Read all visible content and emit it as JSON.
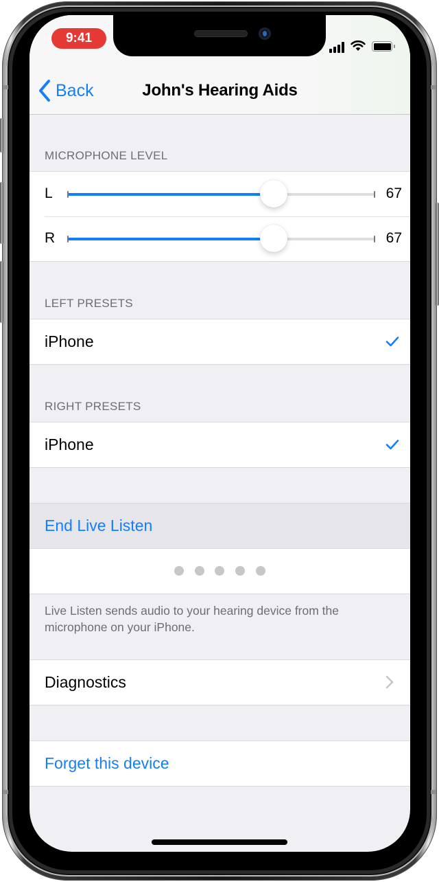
{
  "status_bar": {
    "time": "9:41",
    "time_pill_color": "#e53935",
    "icons": [
      "cellular-signal-icon",
      "wifi-icon",
      "battery-icon"
    ]
  },
  "nav": {
    "back_label": "Back",
    "title": "John's Hearing Aids",
    "accent_color": "#157efb"
  },
  "microphone_level": {
    "header": "MICROPHONE LEVEL",
    "sliders": [
      {
        "side": "L",
        "value": 67,
        "value_label": "67",
        "min": 0,
        "max": 100
      },
      {
        "side": "R",
        "value": 67,
        "value_label": "67",
        "min": 0,
        "max": 100
      }
    ]
  },
  "left_presets": {
    "header": "LEFT PRESETS",
    "items": [
      {
        "label": "iPhone",
        "selected": true
      }
    ]
  },
  "right_presets": {
    "header": "RIGHT PRESETS",
    "items": [
      {
        "label": "iPhone",
        "selected": true
      }
    ]
  },
  "live_listen": {
    "button_label": "End Live Listen",
    "level_dots": 5,
    "footer": "Live Listen sends audio to your hearing device from the microphone on your iPhone."
  },
  "diagnostics": {
    "label": "Diagnostics"
  },
  "forget": {
    "label": "Forget this device"
  }
}
